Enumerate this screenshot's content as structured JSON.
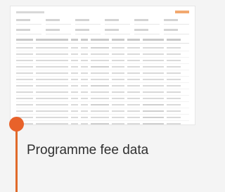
{
  "card": {
    "caption": "Programme fee data",
    "accent_color": "#e8622a"
  },
  "thumbnail": {
    "description_icon": "report-table-icon"
  }
}
